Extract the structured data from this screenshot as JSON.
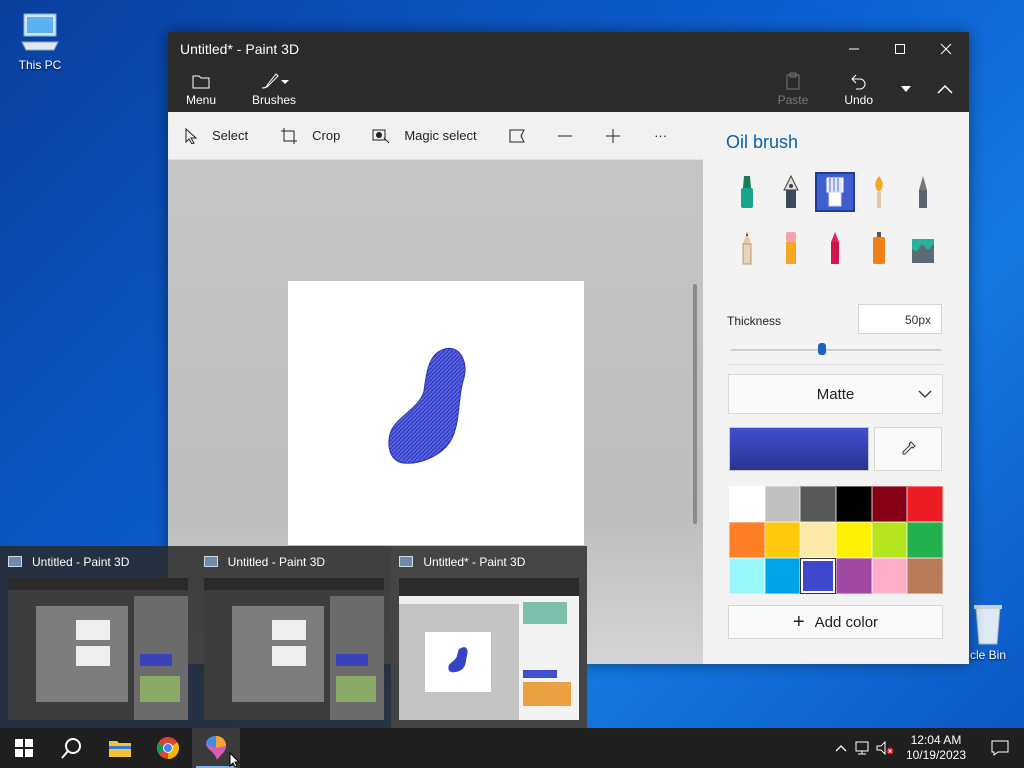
{
  "desktop": {
    "this_pc": "This PC",
    "recycle_bin": "cle Bin"
  },
  "window": {
    "title": "Untitled* - Paint 3D",
    "ribbon": {
      "menu": "Menu",
      "brushes": "Brushes",
      "paste": "Paste",
      "undo": "Undo"
    },
    "toolbar": {
      "select": "Select",
      "crop": "Crop",
      "magic_select": "Magic select",
      "more": "···"
    }
  },
  "panel": {
    "title": "Oil brush",
    "brushes": [
      "marker",
      "calligraphy-pen",
      "oil-brush",
      "watercolor",
      "pixel-pen",
      "pencil",
      "eraser",
      "crayon",
      "spray-can",
      "fill"
    ],
    "selected_brush": "oil-brush",
    "thickness_label": "Thickness",
    "thickness_value": "50px",
    "thickness_fraction": 0.43,
    "finish": "Matte",
    "current_color": "#3f4fd0",
    "palette": [
      "#ffffff",
      "#c0c0c0",
      "#585858",
      "#000000",
      "#880015",
      "#ed1c24",
      "#ff7f27",
      "#ffc90e",
      "#fde9a8",
      "#fff200",
      "#b5e61d",
      "#22b14c",
      "#99f6fb",
      "#00a2e8",
      "#3f48cc",
      "#a349a4",
      "#ffaec9",
      "#b97a57"
    ],
    "selected_swatch": 14,
    "add_color": "Add color"
  },
  "previews": [
    {
      "title": "Untitled - Paint 3D"
    },
    {
      "title": "Untitled - Paint 3D"
    },
    {
      "title": "Untitled* - Paint 3D"
    }
  ],
  "taskbar": {
    "time": "12:04 AM",
    "date": "10/19/2023"
  }
}
